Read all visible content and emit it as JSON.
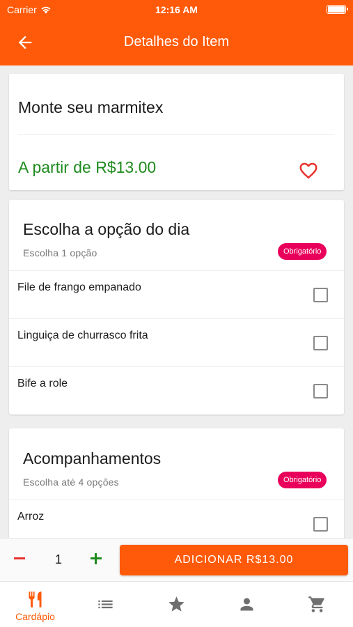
{
  "status_bar": {
    "carrier": "Carrier",
    "time": "12:16 AM"
  },
  "header": {
    "title": "Detalhes do Item",
    "back_icon": "arrow-left-icon"
  },
  "item": {
    "name": "Monte seu marmitex",
    "price": "A partir de R$13.00",
    "favorite_icon": "heart-outline-icon"
  },
  "groups": [
    {
      "title": "Escolha a opção do dia",
      "subtitle": "Escolha 1 opção",
      "badge": "Obrigatório",
      "options": [
        {
          "label": "File de frango empanado",
          "checked": false
        },
        {
          "label": "Linguiça de churrasco frita",
          "checked": false
        },
        {
          "label": "Bife a role",
          "checked": false
        }
      ]
    },
    {
      "title": "Acompanhamentos",
      "subtitle": "Escolha até 4 opções",
      "badge": "Obrigatório",
      "options": [
        {
          "label": "Arroz",
          "checked": false
        }
      ]
    }
  ],
  "cart_bar": {
    "quantity": "1",
    "add_label": "ADICIONAR R$13.00"
  },
  "tabs": [
    {
      "label": "Cardápio",
      "icon": "utensils-icon",
      "active": true
    },
    {
      "label": "",
      "icon": "list-icon",
      "active": false
    },
    {
      "label": "",
      "icon": "star-icon",
      "active": false
    },
    {
      "label": "",
      "icon": "user-icon",
      "active": false
    },
    {
      "label": "",
      "icon": "cart-icon",
      "active": false
    }
  ],
  "colors": {
    "primary": "#fe5a09",
    "price": "#1e8b1e",
    "badge": "#e8005a",
    "favorite": "#e8312c",
    "tab_inactive": "#6f6f6f"
  }
}
